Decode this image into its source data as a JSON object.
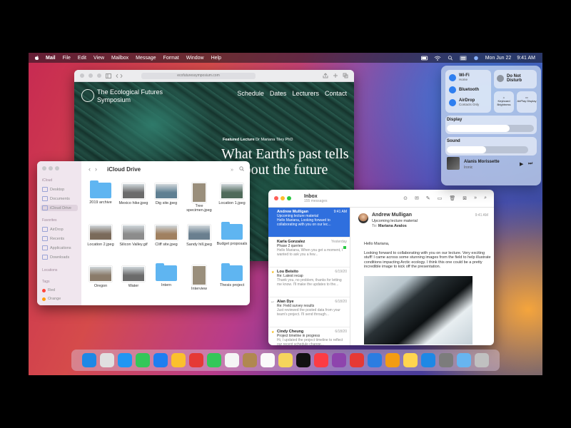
{
  "menubar": {
    "app": "Mail",
    "menus": [
      "File",
      "Edit",
      "View",
      "Mailbox",
      "Message",
      "Format",
      "Window",
      "Help"
    ],
    "date": "Mon Jun 22",
    "time": "9:41 AM"
  },
  "safari": {
    "url": "ecofuturessymposium.com",
    "site_name": "The Ecological Futures Symposium",
    "nav": [
      "Schedule",
      "Dates",
      "Lecturers",
      "Contact"
    ],
    "featured_label": "Featured Lecture",
    "featured_person": "Dr Mariana Tiley PhD",
    "hero": "What Earth's past tells us about the future"
  },
  "finder": {
    "title": "iCloud Drive",
    "sections": {
      "icloud": "iCloud",
      "favorites": "Favorites",
      "locations": "Locations",
      "tags": "Tags"
    },
    "icloud_items": [
      "Desktop",
      "Documents",
      "iCloud Drive"
    ],
    "favorite_items": [
      "AirDrop",
      "Recents",
      "Applications",
      "Downloads"
    ],
    "tag_items": [
      "Red",
      "Orange"
    ],
    "files": [
      {
        "name": "2019 archive",
        "kind": "folder"
      },
      {
        "name": "Mexico hike.jpeg",
        "kind": "photo"
      },
      {
        "name": "Dig site.jpeg",
        "kind": "photo"
      },
      {
        "name": "Tree specimen.jpeg",
        "kind": "portrait"
      },
      {
        "name": "Location 1.jpeg",
        "kind": "photo"
      },
      {
        "name": "Location 2.jpeg",
        "kind": "photo"
      },
      {
        "name": "Silicon Valley.gif",
        "kind": "photo"
      },
      {
        "name": "Cliff site.jpeg",
        "kind": "photo"
      },
      {
        "name": "Sandy hill.jpeg",
        "kind": "photo"
      },
      {
        "name": "Budget proposals",
        "kind": "folder"
      },
      {
        "name": "Oregon",
        "kind": "photo"
      },
      {
        "name": "Water",
        "kind": "photo"
      },
      {
        "name": "Intern",
        "kind": "folder"
      },
      {
        "name": "Interview",
        "kind": "portrait"
      },
      {
        "name": "Thesis project",
        "kind": "folder"
      }
    ]
  },
  "mail": {
    "mailbox": "Inbox",
    "count": "155 messages",
    "messages": [
      {
        "from": "Andrew Mulligan",
        "date": "9:41 AM",
        "subject": "Upcoming lecture material",
        "preview": "Hello Mariana, Looking forward to collaborating with you on our lec..."
      },
      {
        "from": "Karla Gonzalez",
        "date": "Yesterday",
        "subject": "Phase 2 queries",
        "preview": "Hello Mariana, When you get a moment, I wanted to ask you a few..."
      },
      {
        "from": "Lou Beisito",
        "date": "6/19/20",
        "subject": "Re: Latest recap",
        "preview": "Thank you, no problem, thanks for letting me know. I'll make the updates to the..."
      },
      {
        "from": "Alan Dye",
        "date": "6/18/20",
        "subject": "Re: Field survey results",
        "preview": "Just reviewed the posted data from your team's project. I'll send through..."
      },
      {
        "from": "Cindy Cheung",
        "date": "6/18/20",
        "subject": "Project timeline in progress",
        "preview": "Hi, I updated the project timeline to reflect our recent schedule change..."
      }
    ],
    "reader": {
      "from": "Andrew Mulligan",
      "time": "9:41 AM",
      "subject": "Upcoming lecture material",
      "to_label": "To:",
      "to": "Mariana Avalos",
      "greeting": "Hello Mariana,",
      "body": "Looking forward to collaborating with you on our lecture. Very exciting stuff! I came across some stunning images from the field to help illustrate conditions impacting Arctic ecology. I think this one could be a pretty incredible image to kick off the presentation."
    }
  },
  "control_center": {
    "wifi": {
      "label": "Wi-Fi",
      "sub": "Home"
    },
    "bluetooth": {
      "label": "Bluetooth",
      "sub": "On"
    },
    "airdrop": {
      "label": "AirDrop",
      "sub": "Contacts Only"
    },
    "dnd": {
      "label": "Do Not Disturb"
    },
    "keyboard": {
      "label": "Keyboard Brightness"
    },
    "airplay": {
      "label": "AirPlay Display"
    },
    "display": {
      "label": "Display",
      "level": 0.72
    },
    "sound": {
      "label": "Sound",
      "level": 0.48
    },
    "now_playing": {
      "artist": "Alanis Morissette",
      "track": "Ironic"
    }
  },
  "dock": {
    "colors": [
      "#1e88e5",
      "#e0e0e0",
      "#2196f3",
      "#34c759",
      "#1e7ef0",
      "#fbc02d",
      "#e53935",
      "#34c759",
      "#f5f5f5",
      "#b08850",
      "#fafafa",
      "#f5d55c",
      "#111111",
      "#fc3c44",
      "#8e44ad",
      "#e53935",
      "#2a7de1",
      "#f39c12",
      "#ffd54f",
      "#1e88e5",
      "#7c7c7c",
      "#67b5f0",
      "#c0c0c0"
    ]
  }
}
